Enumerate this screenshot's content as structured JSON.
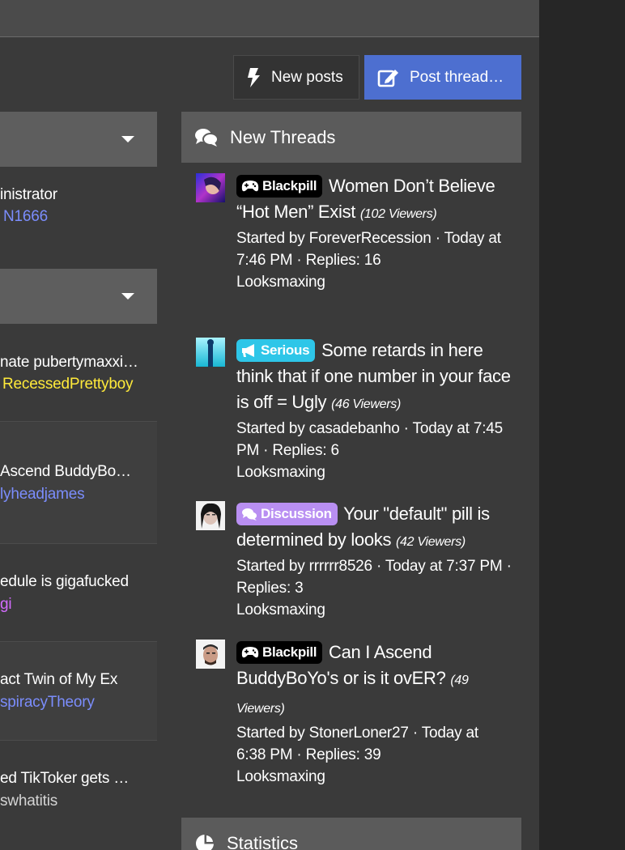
{
  "header": {
    "new_posts_label": "New posts",
    "post_thread_label": "Post thread…"
  },
  "left": {
    "block1": {
      "line1": "inistrator",
      "line2": "N1666"
    },
    "rows": [
      {
        "title": "nate pubertymaxxi…",
        "author": "RecessedPrettyboy",
        "author_color": "#ffea3a"
      },
      {
        "title": "Ascend BuddyBo…",
        "author": "lyheadjames",
        "author_color": "#7b8dfc"
      },
      {
        "title": "edule is gigafucked",
        "author": "gi",
        "author_color": "#d36cff"
      },
      {
        "title": "act Twin of My Ex",
        "author": "spiracyTheory",
        "author_color": "#7b8dfc"
      },
      {
        "title": "ed TikToker gets …",
        "author": "swhatitis",
        "author_color": "#d4d4d4"
      }
    ]
  },
  "new_threads": {
    "heading": "New Threads",
    "icon": "comments-icon",
    "threads": [
      {
        "prefix": "Blackpill",
        "prefix_icon": "gamepad-icon",
        "prefix_color": "#000000",
        "title": "Women Don’t Believe “Hot Men” Exist",
        "viewers": "(102 Viewers)",
        "started": "Started by ForeverRecession · Today at 7:46 PM · Replies: 16",
        "forum": "Looksmaxing"
      },
      {
        "prefix": "Serious",
        "prefix_icon": "megaphone-icon",
        "prefix_color": "#2ec6e8",
        "title": "Some retards in here think that if one number in your face is off = Ugly",
        "viewers": "(46 Viewers)",
        "started": "Started by casadebanho · Today at 7:45 PM · Replies: 6",
        "forum": "Looksmaxing"
      },
      {
        "prefix": "Discussion",
        "prefix_icon": "comments-icon",
        "prefix_color": "#b98ff2",
        "title": "Your \"default\" pill is determined by looks",
        "viewers": "(42 Viewers)",
        "started": "Started by rrrrrr8526 · Today at 7:37 PM · Replies: 3",
        "forum": "Looksmaxing"
      },
      {
        "prefix": "Blackpill",
        "prefix_icon": "gamepad-icon",
        "prefix_color": "#000000",
        "title": "Can I Ascend BuddyBoYo's or is it ovER?",
        "viewers": "(49 Viewers)",
        "started": "Started by StonerLoner27 · Today at 6:38 PM · Replies: 39",
        "forum": "Looksmaxing"
      }
    ]
  },
  "statistics": {
    "heading": "Statistics",
    "icon": "pie-chart-icon"
  }
}
